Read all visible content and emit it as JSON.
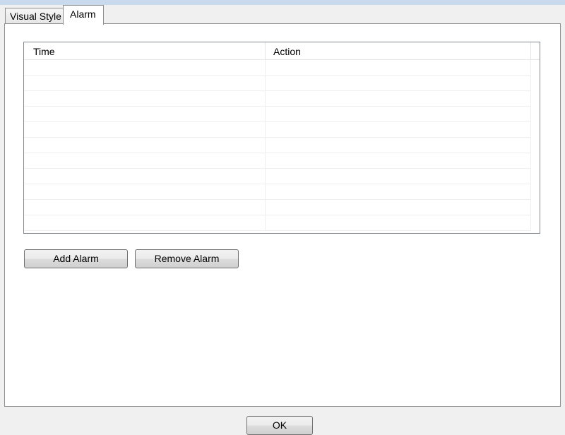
{
  "tabs": [
    {
      "label": "Visual Style",
      "active": false
    },
    {
      "label": "Alarm",
      "active": true
    }
  ],
  "alarm_list": {
    "columns": [
      "Time",
      "Action"
    ],
    "rows": []
  },
  "buttons": {
    "add_alarm": "Add Alarm",
    "remove_alarm": "Remove Alarm",
    "ok": "OK"
  }
}
